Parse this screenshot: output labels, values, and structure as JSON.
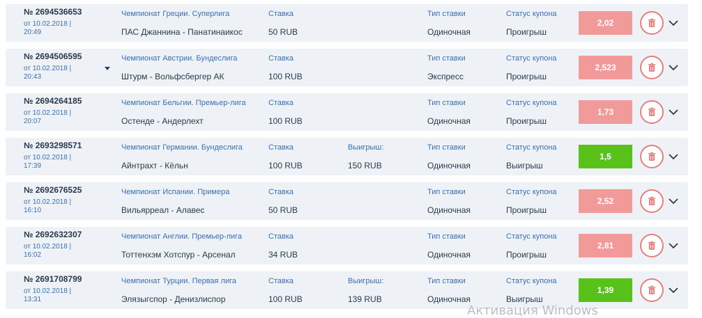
{
  "colors": {
    "row_bg": "#eef2f6",
    "label_blue": "#3a6fb0",
    "text_dark": "#2a3a4c",
    "loss_coef": "#f29a9a",
    "win_coef": "#59c21a",
    "trash_red": "#e67e7e"
  },
  "icons": {
    "delete": "trash-icon",
    "expand": "chevron-down-icon",
    "dropdown": "caret-down-icon"
  },
  "labels": {
    "stake": "Ставка",
    "win": "Выигрыш:",
    "type": "Тип ставки",
    "status": "Статус купона"
  },
  "bets": [
    {
      "number": "№ 2694536653",
      "date_line1": "от 10.02.2018 |",
      "date_line2": "20:49",
      "championship": "Чемпионат Греции. Суперлига",
      "match": "ПАС Джаннина - Панатинаикос",
      "stake": "50 RUB",
      "winnings": "",
      "type": "Одиночная",
      "status": "Проигрыш",
      "coefficient": "2,02",
      "result": "loss"
    },
    {
      "number": "№ 2694506595",
      "date_line1": "от 10.02.2018 |",
      "date_line2": "20:43",
      "championship": "Чемпионат Австрии. Бундеслига",
      "match": "Штурм - Вольфсбергер АК",
      "stake": "100 RUB",
      "winnings": "",
      "type": "Экспресс",
      "status": "Проигрыш",
      "coefficient": "2,523",
      "result": "loss",
      "has_caret": true
    },
    {
      "number": "№ 2694264185",
      "date_line1": "от 10.02.2018 |",
      "date_line2": "20:07",
      "championship": "Чемпионат Бельгии. Премьер-лига",
      "match": "Остенде - Андерлехт",
      "stake": "100 RUB",
      "winnings": "",
      "type": "Одиночная",
      "status": "Проигрыш",
      "coefficient": "1,73",
      "result": "loss"
    },
    {
      "number": "№ 2693298571",
      "date_line1": "от 10.02.2018 |",
      "date_line2": "17:39",
      "championship": "Чемпионат Германии. Бундеслига",
      "match": "Айнтрахт - Кёльн",
      "stake": "100 RUB",
      "winnings": "150 RUB",
      "type": "Одиночная",
      "status": "Выигрыш",
      "coefficient": "1,5",
      "result": "win"
    },
    {
      "number": "№ 2692676525",
      "date_line1": "от 10.02.2018 |",
      "date_line2": "16:10",
      "championship": "Чемпионат Испании. Примера",
      "match": "Вильярреал - Алавес",
      "stake": "50 RUB",
      "winnings": "",
      "type": "Одиночная",
      "status": "Проигрыш",
      "coefficient": "2,52",
      "result": "loss"
    },
    {
      "number": "№ 2692632307",
      "date_line1": "от 10.02.2018 |",
      "date_line2": "16:02",
      "championship": "Чемпионат Англии. Премьер-лига",
      "match": "Тоттенхэм Хотспур - Арсенал",
      "stake": "34 RUB",
      "winnings": "",
      "type": "Одиночная",
      "status": "Проигрыш",
      "coefficient": "2,81",
      "result": "loss"
    },
    {
      "number": "№ 2691708799",
      "date_line1": "от 10.02.2018 |",
      "date_line2": "13:31",
      "championship": "Чемпионат Турции. Первая лига",
      "match": "Элязыгспор - Денизлиспор",
      "stake": "100 RUB",
      "winnings": "139 RUB",
      "type": "Одиночная",
      "status": "Выигрыш",
      "coefficient": "1,39",
      "result": "win"
    }
  ],
  "watermark": "Активация Windows"
}
